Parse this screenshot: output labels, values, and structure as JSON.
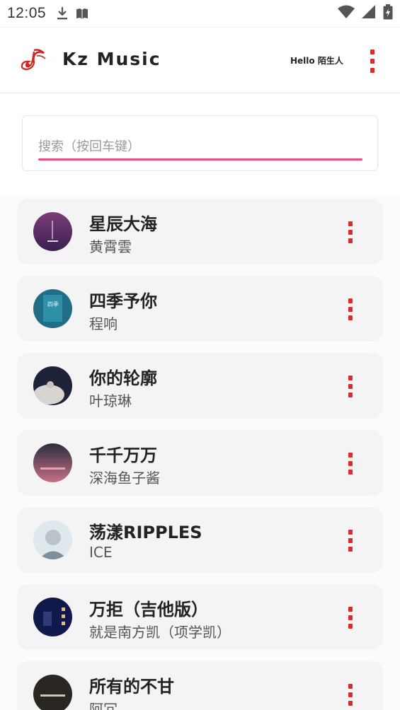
{
  "status_bar": {
    "time": "12:05",
    "icons": [
      "download-icon",
      "book-icon",
      "wifi-icon",
      "signal-icon",
      "battery-icon"
    ]
  },
  "header": {
    "app_title": "Kz Music",
    "greeting": "Hello 陌生人",
    "logo_icon": "music-note-logo-icon",
    "menu_icon": "more-vert-icon"
  },
  "search": {
    "placeholder": "搜索（按回车键）",
    "value": ""
  },
  "colors": {
    "accent": "#e02a2a",
    "search_underline": "#ea4d7f",
    "card_bg": "#f4f4f4"
  },
  "songs": [
    {
      "title": "星辰大海",
      "artist": "黄霄雲"
    },
    {
      "title": "四季予你",
      "artist": "程响"
    },
    {
      "title": "你的轮廓",
      "artist": "叶琼琳"
    },
    {
      "title": "千千万万",
      "artist": "深海鱼子酱"
    },
    {
      "title": "荡漾RIPPLES",
      "artist": "ICE"
    },
    {
      "title": "万拒（吉他版）",
      "artist": "就是南方凯（项学凯）"
    },
    {
      "title": "所有的不甘",
      "artist": "阿冗"
    }
  ]
}
